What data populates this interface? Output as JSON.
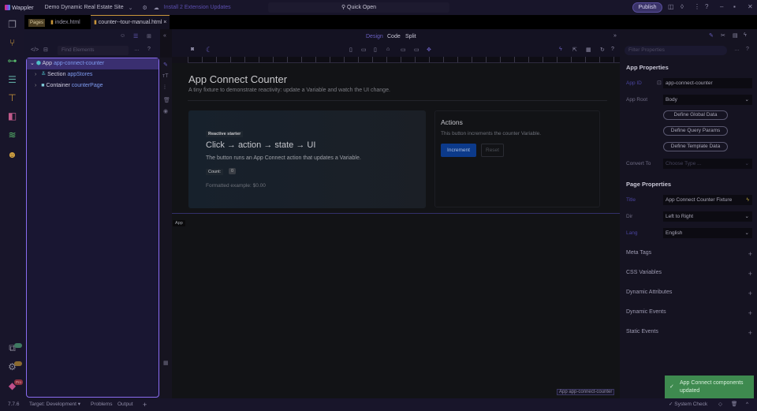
{
  "topbar": {
    "app": "Wappler",
    "site": "Demo Dynamic Real Estate Site",
    "updates": "Install 2 Extension Updates",
    "quick_open": "Quick Open",
    "publish": "Publish"
  },
  "tabs": {
    "pages_label": "Pages",
    "items": [
      "index.html",
      "counter--tour-manual.html"
    ]
  },
  "left": {
    "search_placeholder": "Find Elements",
    "tree": [
      {
        "type": "App",
        "id": "app-connect-counter"
      },
      {
        "type": "Section",
        "id": "appStores"
      },
      {
        "type": "Container",
        "id": "counterPage"
      }
    ]
  },
  "modes": [
    "Design",
    "Code",
    "Split"
  ],
  "page": {
    "title": "App Connect Counter",
    "subtitle": "A tiny fixture to demonstrate reactivity: update a Variable and watch the UI change.",
    "hero": {
      "badge": "Reactive starter",
      "heading": "Click → action → state → UI",
      "text": "The button runs an App Connect action that updates a Variable.",
      "count_label": "Count:",
      "count": "0",
      "formatted": "Formatted example: $0.00"
    },
    "actions": {
      "title": "Actions",
      "text": "This button increments the counter Variable.",
      "increment": "Increment",
      "reset": "Reset"
    },
    "selection_tag": "App",
    "footer_tag": "App app-connect-counter"
  },
  "right": {
    "filter_placeholder": "Filter Properties",
    "app_props": {
      "title": "App Properties",
      "app_id_label": "App ID",
      "app_id": "app-connect-counter",
      "app_root_label": "App Root",
      "app_root": "Body",
      "buttons": [
        "Define Global Data",
        "Define Query Params",
        "Define Template Data"
      ],
      "convert_label": "Convert To",
      "convert_placeholder": "Choose Type ..."
    },
    "page_props": {
      "title": "Page Properties",
      "title_label": "Title",
      "title_value": "App Connect Counter Fixture",
      "dir_label": "Dir",
      "dir_value": "Left to Right",
      "lang_label": "Lang",
      "lang_value": "English"
    },
    "sections": [
      "Meta Tags",
      "CSS Variables",
      "Dynamic Attributes",
      "Dynamic Events",
      "Static Events"
    ]
  },
  "status": {
    "version": "7.7.6",
    "target": "Target: Development",
    "problems": "Problems",
    "output": "Output",
    "system_check": "System Check"
  },
  "badges": {
    "pro": "Pro"
  },
  "toast": "App Connect components updated"
}
